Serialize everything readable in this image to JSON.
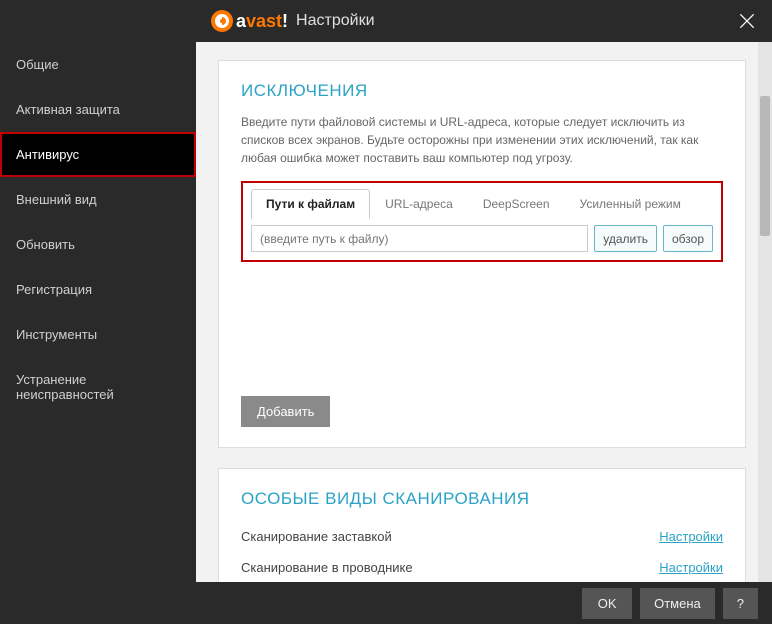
{
  "header": {
    "logo_text": "avast!",
    "title_suffix": "Настройки"
  },
  "sidebar": {
    "items": [
      {
        "label": "Общие"
      },
      {
        "label": "Активная защита"
      },
      {
        "label": "Антивирус"
      },
      {
        "label": "Внешний вид"
      },
      {
        "label": "Обновить"
      },
      {
        "label": "Регистрация"
      },
      {
        "label": "Инструменты"
      },
      {
        "label": "Устранение неисправностей"
      }
    ],
    "active_index": 2
  },
  "exclusions": {
    "title": "ИСКЛЮЧЕНИЯ",
    "description": "Введите пути файловой системы и URL-адреса, которые следует исключить из списков всех экранов. Будьте осторожны при изменении этих исключений, так как любая ошибка может поставить ваш компьютер под угрозу.",
    "tabs": [
      {
        "label": "Пути к файлам"
      },
      {
        "label": "URL-адреса"
      },
      {
        "label": "DeepScreen"
      },
      {
        "label": "Усиленный режим"
      }
    ],
    "active_tab": 0,
    "path_placeholder": "(введите путь к файлу)",
    "delete_label": "удалить",
    "browse_label": "обзор",
    "add_label": "Добавить"
  },
  "special_scans": {
    "title": "ОСОБЫЕ ВИДЫ СКАНИРОВАНИЯ",
    "rows": [
      {
        "label": "Сканирование заставкой",
        "link": "Настройки"
      },
      {
        "label": "Сканирование в проводнике",
        "link": "Настройки"
      }
    ]
  },
  "footer": {
    "ok": "OK",
    "cancel": "Отмена",
    "help": "?"
  }
}
